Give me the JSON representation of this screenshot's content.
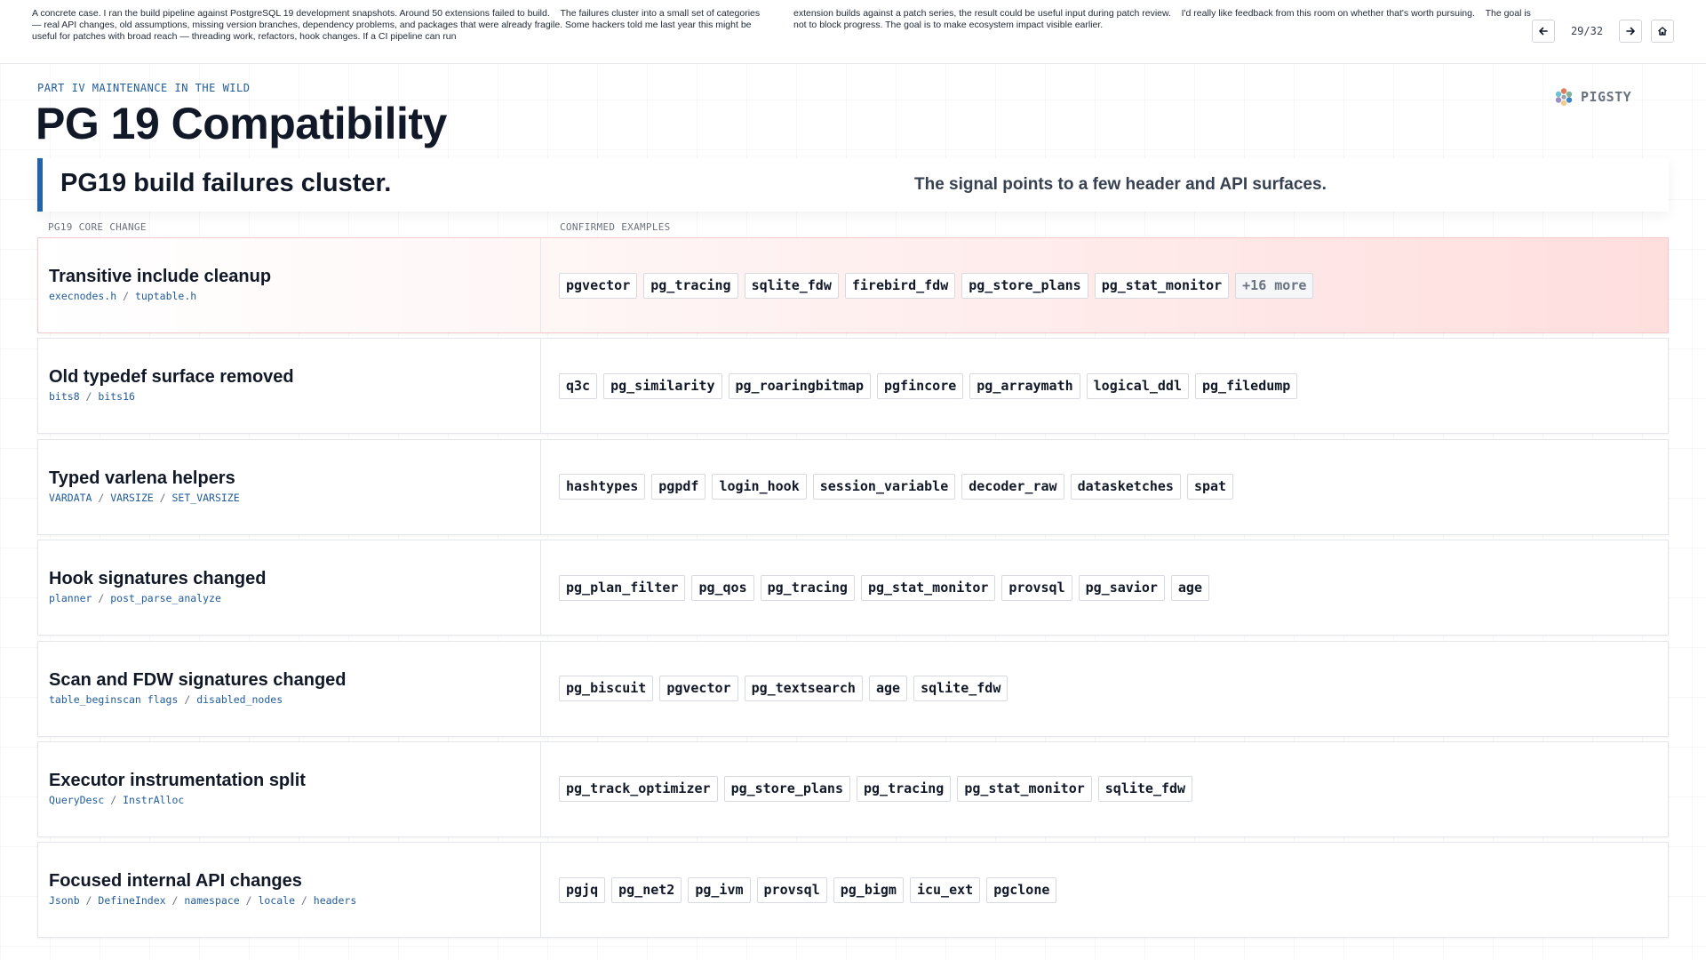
{
  "notes": {
    "left": [
      "A concrete case. I ran the build pipeline against PostgreSQL 19 development snapshots. Around 50 extensions failed to build.",
      "The failures cluster into a small set of categories — real API changes, old assumptions, missing version branches, dependency problems, and packages that were already fragile. Some hackers told me last year this might be useful for patches with broad reach — threading work, refactors, hook changes. If a CI pipeline can run"
    ],
    "right": [
      "extension builds against a patch series, the result could be useful input during patch review.",
      "I'd really like feedback from this room on whether that's worth pursuing.",
      "The goal is not to block progress. The goal is to make ecosystem impact visible earlier."
    ]
  },
  "nav": {
    "page": "29/32",
    "prev_icon": "arrow-left-icon",
    "next_icon": "arrow-right-icon",
    "home_icon": "home-icon"
  },
  "slide": {
    "kicker": "PART IV MAINTENANCE IN THE WILD",
    "title": "PG 19 Compatibility",
    "brand": "PIGSTY",
    "banner_headline": "PG19 build failures cluster.",
    "banner_subline": "The signal points to a few header and API surfaces."
  },
  "table": {
    "headers": [
      "PG19 CORE CHANGE",
      "CONFIRMED EXAMPLES"
    ],
    "rows": [
      {
        "title": "Transitive include cleanup",
        "symbols": [
          "execnodes.h",
          "tuptable.h"
        ],
        "chips": [
          "pgvector",
          "pg_tracing",
          "sqlite_fdw",
          "firebird_fdw",
          "pg_store_plans",
          "pg_stat_monitor"
        ],
        "more": "+16 more",
        "highlight": true
      },
      {
        "title": "Old typedef surface removed",
        "symbols": [
          "bits8",
          "bits16"
        ],
        "chips": [
          "q3c",
          "pg_similarity",
          "pg_roaringbitmap",
          "pgfincore",
          "pg_arraymath",
          "logical_ddl",
          "pg_filedump"
        ]
      },
      {
        "title": "Typed varlena helpers",
        "symbols": [
          "VARDATA",
          "VARSIZE",
          "SET_VARSIZE"
        ],
        "chips": [
          "hashtypes",
          "pgpdf",
          "login_hook",
          "session_variable",
          "decoder_raw",
          "datasketches",
          "spat"
        ]
      },
      {
        "title": "Hook signatures changed",
        "symbols": [
          "planner",
          "post_parse_analyze"
        ],
        "chips": [
          "pg_plan_filter",
          "pg_qos",
          "pg_tracing",
          "pg_stat_monitor",
          "provsql",
          "pg_savior",
          "age"
        ]
      },
      {
        "title": "Scan and FDW signatures changed",
        "symbols": [
          "table_beginscan flags",
          "disabled_nodes"
        ],
        "chips": [
          "pg_biscuit",
          "pgvector",
          "pg_textsearch",
          "age",
          "sqlite_fdw"
        ]
      },
      {
        "title": "Executor instrumentation split",
        "symbols": [
          "QueryDesc",
          "InstrAlloc"
        ],
        "chips": [
          "pg_track_optimizer",
          "pg_store_plans",
          "pg_tracing",
          "pg_stat_monitor",
          "sqlite_fdw"
        ]
      },
      {
        "title": "Focused internal API changes",
        "symbols": [
          "Jsonb",
          "DefineIndex",
          "namespace",
          "locale",
          "headers"
        ],
        "chips": [
          "pgjq",
          "pg_net2",
          "pg_ivm",
          "provsql",
          "pg_bigm",
          "icu_ext",
          "pgclone"
        ]
      }
    ]
  },
  "colors": {
    "accent": "#2563a8",
    "code": "#1f5b9a",
    "highlight": "#ffdede"
  }
}
